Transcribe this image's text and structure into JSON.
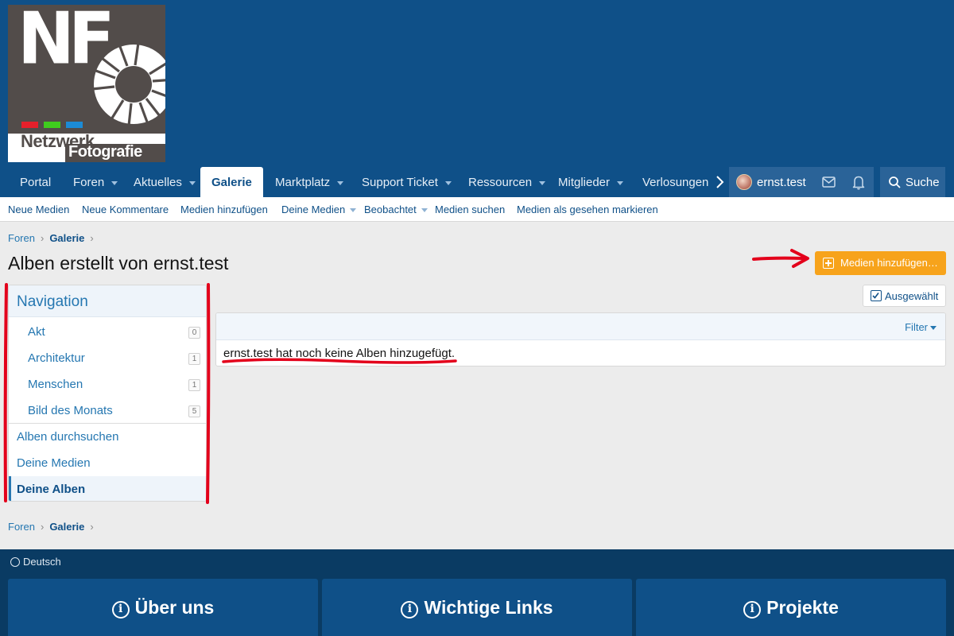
{
  "logo": {
    "letters": "NF",
    "line1": "Netzwerk",
    "line2": "Fotografie",
    "colors": [
      "#e5202b",
      "#3fcc1e",
      "#1c8bd6"
    ]
  },
  "nav": {
    "items": [
      {
        "label": "Portal"
      },
      {
        "label": "Foren"
      },
      {
        "label": "Aktuelles"
      },
      {
        "label": "Galerie"
      },
      {
        "label": "Marktplatz"
      },
      {
        "label": "Support Ticket"
      },
      {
        "label": "Ressourcen"
      },
      {
        "label": "Mitglieder"
      },
      {
        "label": "Verlosungen"
      }
    ],
    "active": "Galerie",
    "user": "ernst.test",
    "search": "Suche"
  },
  "subnav": {
    "items": [
      "Neue Medien",
      "Neue Kommentare",
      "Medien hinzufügen",
      "Deine Medien",
      "Beobachtet",
      "Medien suchen",
      "Medien als gesehen markieren"
    ]
  },
  "breadcrumb": {
    "first": "Foren",
    "second": "Galerie"
  },
  "page": {
    "title": "Alben erstellt von ernst.test",
    "add_button": "Medien hinzufügen…",
    "selected_button": "Ausgewählt",
    "filter": "Filter",
    "empty_message": "ernst.test hat noch keine Alben hinzugefügt."
  },
  "sidebar": {
    "title": "Navigation",
    "categories": [
      {
        "name": "Akt",
        "count": "0"
      },
      {
        "name": "Architektur",
        "count": "1"
      },
      {
        "name": "Menschen",
        "count": "1"
      },
      {
        "name": "Bild des Monats",
        "count": "5"
      }
    ],
    "links": [
      {
        "name": "Alben durchsuchen"
      },
      {
        "name": "Deine Medien"
      },
      {
        "name": "Deine Alben"
      }
    ]
  },
  "footer": {
    "language": "Deutsch",
    "boxes": [
      "Über uns",
      "Wichtige Links",
      "Projekte"
    ]
  },
  "colors": {
    "header": "#0f5088",
    "accent_button": "#f7a31b",
    "annotation": "#e3001b",
    "footer": "#0a3b63"
  }
}
